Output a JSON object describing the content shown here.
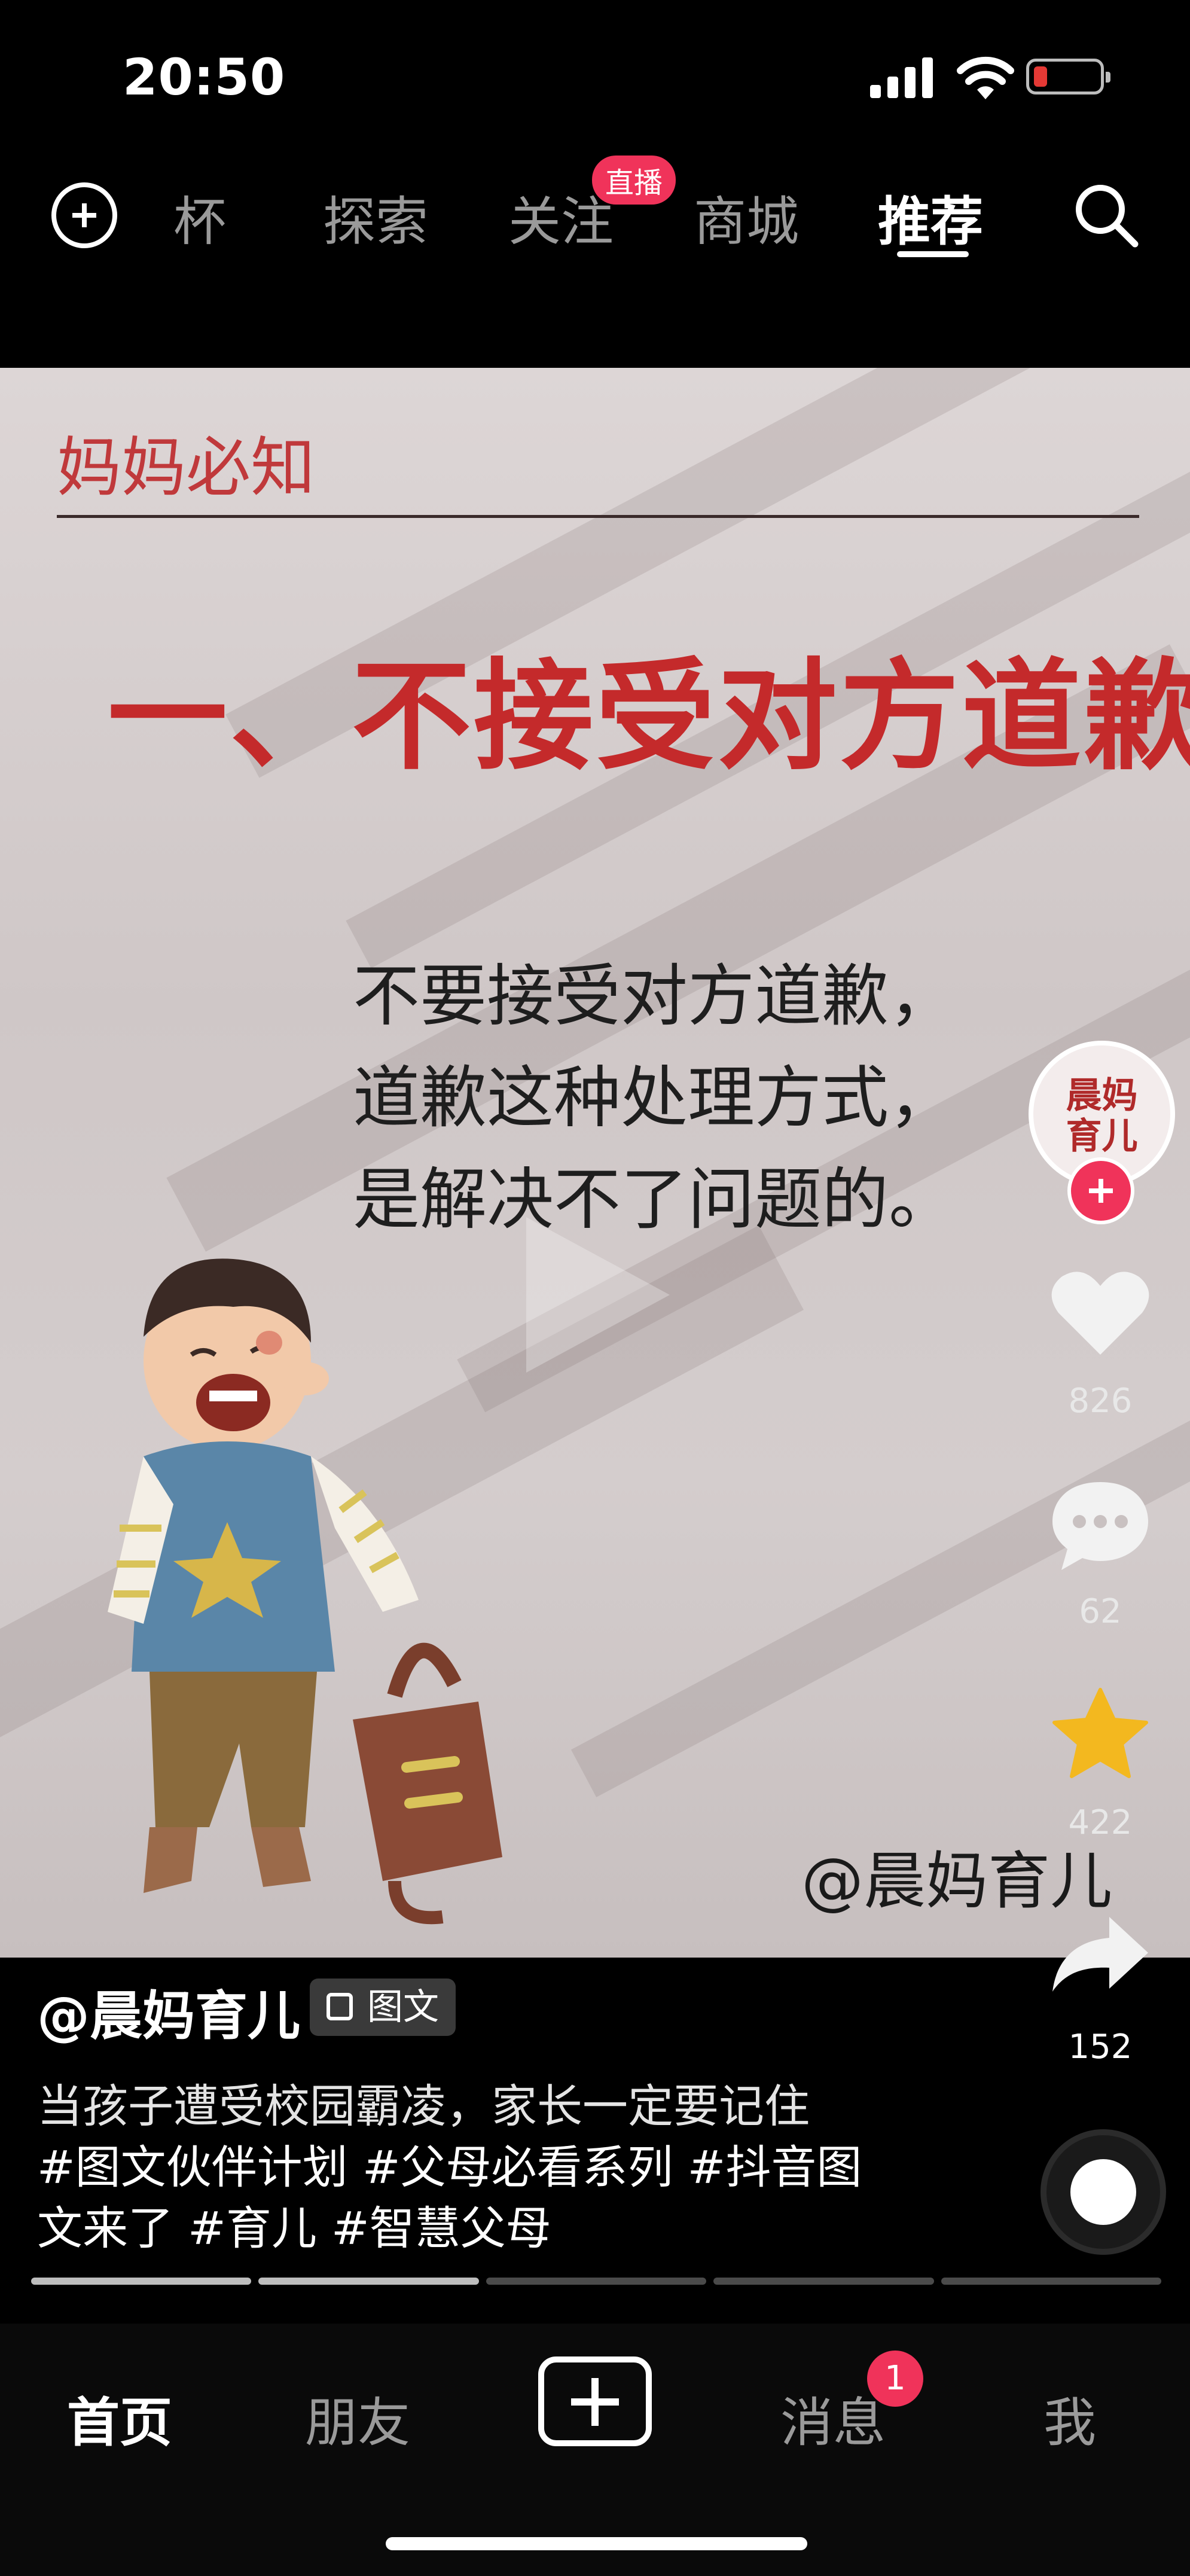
{
  "status_bar": {
    "time": "20:50"
  },
  "top_nav": {
    "tabs": [
      {
        "label": "杯"
      },
      {
        "label": "探索"
      },
      {
        "label": "关注"
      },
      {
        "label": "商城"
      },
      {
        "label": "推荐"
      }
    ],
    "active_tab": "推荐",
    "live_badge": "直播"
  },
  "post": {
    "section_label": "妈妈必知",
    "headline": "一、不接受对方道歉",
    "body_lines": [
      "不要接受对方道歉，",
      "道歉这种处理方式，",
      "是解决不了问题的。"
    ],
    "watermark": "@晨妈育儿"
  },
  "right_rail": {
    "avatar_text": [
      "晨妈",
      "育儿"
    ],
    "likes": "826",
    "comments": "62",
    "favorites": "422",
    "shares": "152"
  },
  "caption": {
    "author": "@晨妈育儿",
    "type_badge": "图文",
    "lines": [
      "当孩子遭受校园霸凌，家长一定要记住",
      "#图文伙伴计划 #父母必看系列 #抖音图",
      "文来了 #育儿 #智慧父母"
    ]
  },
  "progress": {
    "segments": 5,
    "active_segment": 2
  },
  "bottom_nav": {
    "tabs": [
      {
        "label": "首页"
      },
      {
        "label": "朋友"
      },
      {
        "label": "消息"
      },
      {
        "label": "我"
      }
    ],
    "active_tab": "首页",
    "message_badge": "1"
  },
  "colors": {
    "accent": "#f0335a",
    "headline_red": "#c42a2b"
  }
}
